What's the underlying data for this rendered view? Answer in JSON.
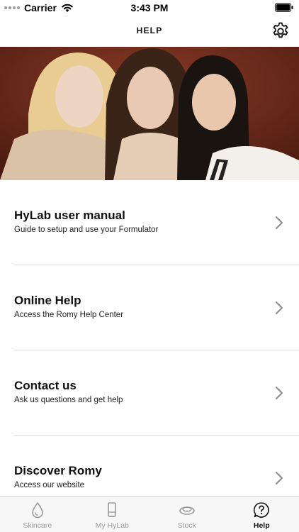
{
  "status_bar": {
    "carrier": "Carrier",
    "time": "3:43 PM"
  },
  "header": {
    "title": "HELP",
    "settings_icon": "gear-icon"
  },
  "hero": {
    "description_icon": "photo"
  },
  "menu": [
    {
      "title": "HyLab user manual",
      "subtitle": "Guide to setup and use your Formulator"
    },
    {
      "title": "Online Help",
      "subtitle": "Access the Romy Help Center"
    },
    {
      "title": "Contact us",
      "subtitle": "Ask us questions and get help"
    },
    {
      "title": "Discover Romy",
      "subtitle": "Access our website"
    }
  ],
  "tabs": [
    {
      "label": "Skincare",
      "icon": "drop-icon",
      "active": false
    },
    {
      "label": "My HyLab",
      "icon": "device-icon",
      "active": false
    },
    {
      "label": "Stock",
      "icon": "capsule-icon",
      "active": false
    },
    {
      "label": "Help",
      "icon": "help-icon",
      "active": true
    }
  ],
  "colors": {
    "active_tab": "#111111",
    "inactive_tab": "#9a9a9a",
    "divider": "#dcdcdc"
  }
}
